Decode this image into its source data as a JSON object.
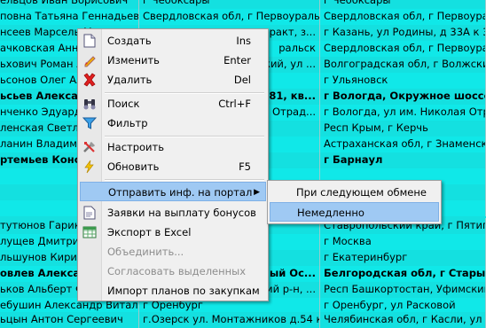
{
  "rows": [
    {
      "name": "ельцов Иван Борисович",
      "city": "г Чебоксары",
      "address": "г Чебоксары",
      "bold": false
    },
    {
      "name": "повна Татьяна Геннадьевна",
      "city": "Свердловская обл, г Первоуральск",
      "address": "Свердловская обл, г Первоуральск",
      "bold": false
    },
    {
      "name": "нсеев Марсель Ма",
      "city": "ракт, з...",
      "address": "г Казань, ул Родины, д 33А к 3",
      "bold": false
    },
    {
      "name": "ачковская Анна К",
      "city": "ральск",
      "address": "Свердловская обл, г Первоуральск",
      "bold": false
    },
    {
      "name": "ьхович Роман Ale",
      "city": "ский, ул ...",
      "address": "Волгоградская обл, г Волжский, ул",
      "bold": false
    },
    {
      "name": "ьсонов Олег Алек",
      "city": "",
      "address": "г Ульяновск",
      "bold": false
    },
    {
      "name": "ьсьев Алексан",
      "city": "д 81, кв...",
      "address": "г Вологда, Окружное шоссе, д",
      "bold": true
    },
    {
      "name": "нченко Эдуард",
      "city": "Отрад...",
      "address": "г Вологда, ул им. Николая Отрад",
      "bold": false
    },
    {
      "name": "ленская Светлан",
      "city": "",
      "address": "Респ Крым, г Керчь",
      "bold": false
    },
    {
      "name": "ланин Владимир А",
      "city": "",
      "address": "Астраханская обл, г Знаменск",
      "bold": false
    },
    {
      "name": "ртемьев Конста",
      "city": "",
      "address": "г Барнаул",
      "bold": true
    },
    {
      "name": "",
      "city": "",
      "address": "",
      "bold": false
    },
    {
      "name": "",
      "city": "",
      "address": "",
      "bold": false
    },
    {
      "name": "",
      "city": "",
      "address": "",
      "bold": false
    },
    {
      "name": "тутюнов Гарик Гр",
      "city": "тигорск",
      "address": "Ставропольский край, г Пятигорск",
      "bold": false
    },
    {
      "name": "лущев Дмитрий",
      "city": "",
      "address": "г Москва",
      "bold": false
    },
    {
      "name": "льшунов Кирилл",
      "city": "",
      "address": "г Екатеринбург",
      "bold": false
    },
    {
      "name": "овлев Алексан",
      "city": "ый Ос...",
      "address": "Белгородская обл, г Старый Ос",
      "bold": true
    },
    {
      "name": "ьков Альберт Ф",
      "city": "ий р-н, ...",
      "address": "Респ Башкортостан, Уфимский р-н,",
      "bold": false
    },
    {
      "name": "ебушин Александр Витальевич",
      "city": "г Оренбург",
      "address": "г Оренбург, ул Расковой",
      "bold": false
    },
    {
      "name": "ьцын Антон Сергеевич",
      "city": "г.Озерск ул. Монтажников д.54 кв...",
      "address": "Челябинская обл, г Касли, ул Лоба",
      "bold": false
    }
  ],
  "menu": {
    "items": [
      {
        "icon": "new-document-icon",
        "label": "Создать",
        "shortcut": "Ins"
      },
      {
        "icon": "pencil-icon",
        "label": "Изменить",
        "shortcut": "Enter"
      },
      {
        "icon": "red-x-icon",
        "label": "Удалить",
        "shortcut": "Del"
      },
      {
        "icon": "binoculars-icon",
        "label": "Поиск",
        "shortcut": "Ctrl+F"
      },
      {
        "icon": "funnel-icon",
        "label": "Фильтр",
        "shortcut": ""
      },
      {
        "icon": "tools-icon",
        "label": "Настроить",
        "shortcut": ""
      },
      {
        "icon": "lightning-icon",
        "label": "Обновить",
        "shortcut": "F5"
      },
      {
        "icon": "",
        "label": "Отправить инф. на портал",
        "shortcut": ""
      },
      {
        "icon": "document-icon",
        "label": "Заявки на выплату бонусов",
        "shortcut": ""
      },
      {
        "icon": "excel-icon",
        "label": "Экспорт в Excel",
        "shortcut": ""
      },
      {
        "icon": "",
        "label": "Объединить...",
        "shortcut": ""
      },
      {
        "icon": "",
        "label": "Согласовать выделенных",
        "shortcut": ""
      },
      {
        "icon": "",
        "label": "Импорт планов по закупкам",
        "shortcut": ""
      }
    ]
  },
  "submenu": {
    "items": [
      {
        "label": "При следующем обмене"
      },
      {
        "label": "Немедленно"
      }
    ]
  },
  "colors": {
    "grid_bg": "#14e0e0",
    "highlight": "#9fc9f3",
    "menu_bg": "#f0f0f0"
  }
}
